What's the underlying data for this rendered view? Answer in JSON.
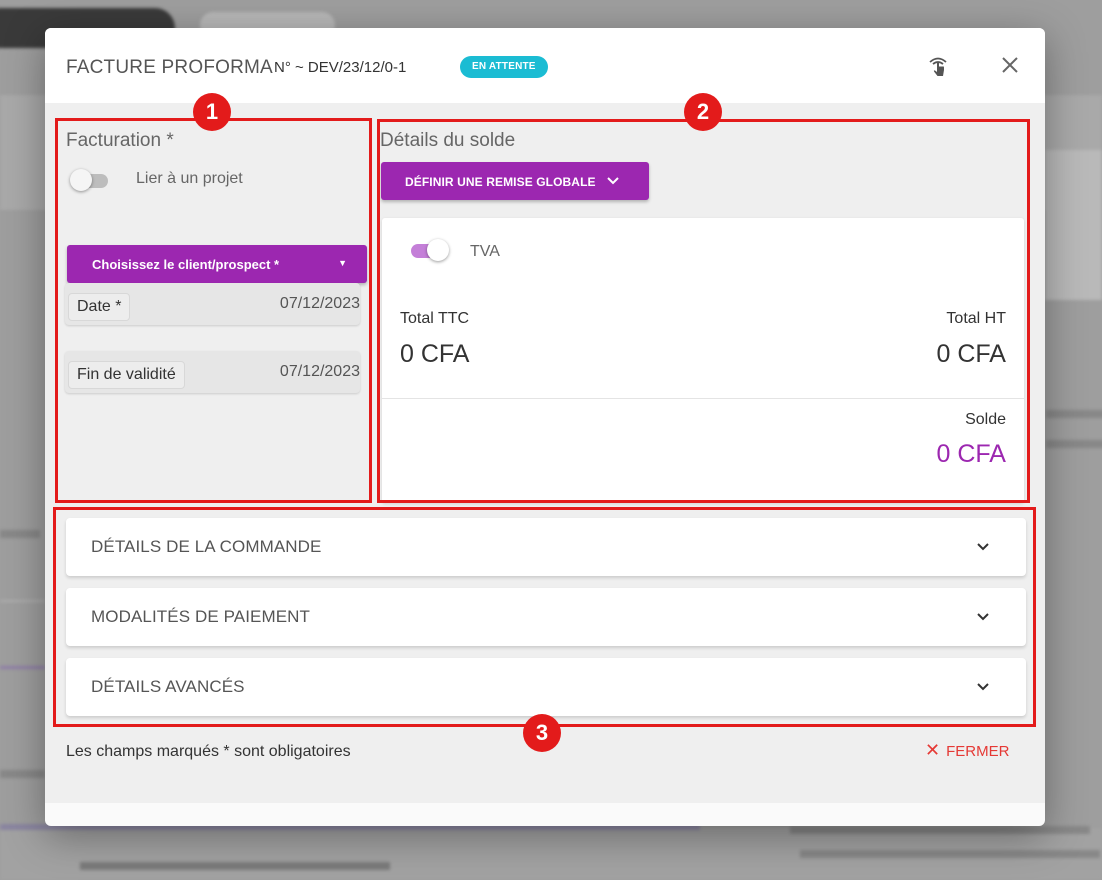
{
  "modal": {
    "title": "FACTURE PROFORMA",
    "doc_number": "N° ~ DEV/23/12/0-1",
    "status": "EN ATTENTE",
    "touch_icon": "tap-hand-icon",
    "close_icon": "close-icon"
  },
  "facturation": {
    "title": "Facturation *",
    "link_project_label": "Lier à un projet",
    "link_project_enabled": false,
    "client_select_label": "Choisissez le client/prospect *",
    "date_label": "Date *",
    "date_value": "07/12/2023",
    "validity_label": "Fin de validité",
    "validity_value": "07/12/2023"
  },
  "solde": {
    "title": "Détails du solde",
    "remise_button": "DÉFINIR UNE REMISE GLOBALE",
    "tva_label": "TVA",
    "tva_enabled": true,
    "total_ttc_label": "Total TTC",
    "total_ttc_value": "0 CFA",
    "total_ht_label": "Total HT",
    "total_ht_value": "0 CFA",
    "solde_label": "Solde",
    "solde_value": "0 CFA"
  },
  "sections": [
    {
      "label": "DÉTAILS DE LA COMMANDE"
    },
    {
      "label": "MODALITÉS DE PAIEMENT"
    },
    {
      "label": "DÉTAILS AVANCÉS"
    }
  ],
  "footer": {
    "required_note": "Les champs marqués * sont obligatoires",
    "close_button": "FERMER"
  },
  "annotations": {
    "badge_1": "1",
    "badge_2": "2",
    "badge_3": "3"
  },
  "colors": {
    "accent": "#9c27b0",
    "status_badge": "#1bbcd3",
    "annotation": "#e31b1b",
    "close": "#e53935"
  }
}
